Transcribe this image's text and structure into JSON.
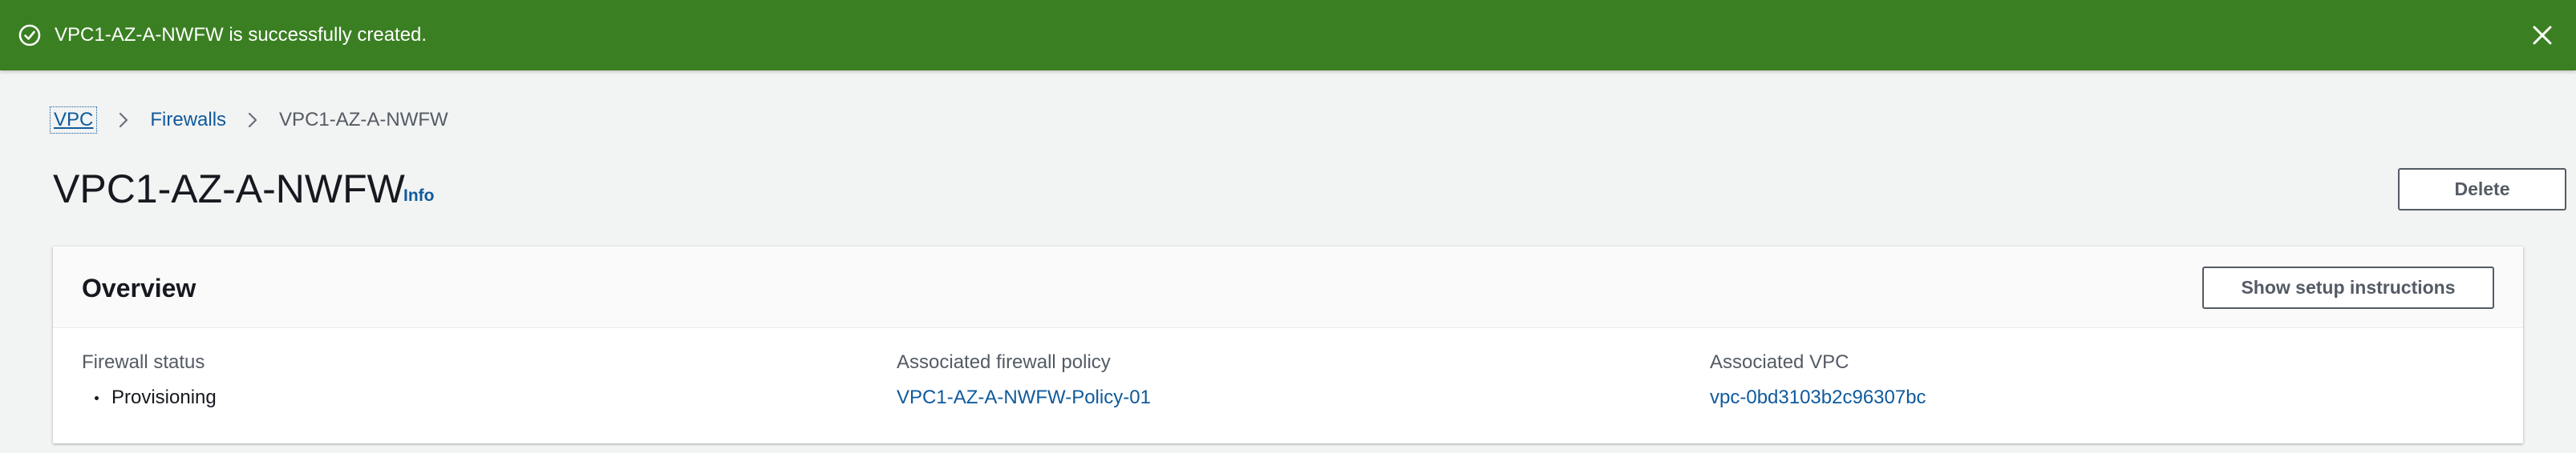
{
  "banner": {
    "message": "VPC1-AZ-A-NWFW is successfully created.",
    "type": "success",
    "color": "#3b7f23",
    "icon": "check-circle-icon",
    "close_icon": "close-icon"
  },
  "breadcrumb": {
    "items": [
      {
        "label": "VPC"
      },
      {
        "label": "Firewalls"
      },
      {
        "label": "VPC1-AZ-A-NWFW"
      }
    ],
    "separator_icon": "chevron-right-icon"
  },
  "header": {
    "title": "VPC1-AZ-A-NWFW",
    "info_label": "Info",
    "delete_label": "Delete"
  },
  "overview": {
    "title": "Overview",
    "setup_button_label": "Show setup instructions",
    "firewall_status": {
      "label": "Firewall status",
      "value": "Provisioning"
    },
    "firewall_policy": {
      "label": "Associated firewall policy",
      "value": "VPC1-AZ-A-NWFW-Policy-01"
    },
    "vpc": {
      "label": "Associated VPC",
      "value": "vpc-0bd3103b2c96307bc"
    }
  },
  "colors": {
    "link": "#0f5a9c",
    "page_background": "#f2f3f3"
  }
}
